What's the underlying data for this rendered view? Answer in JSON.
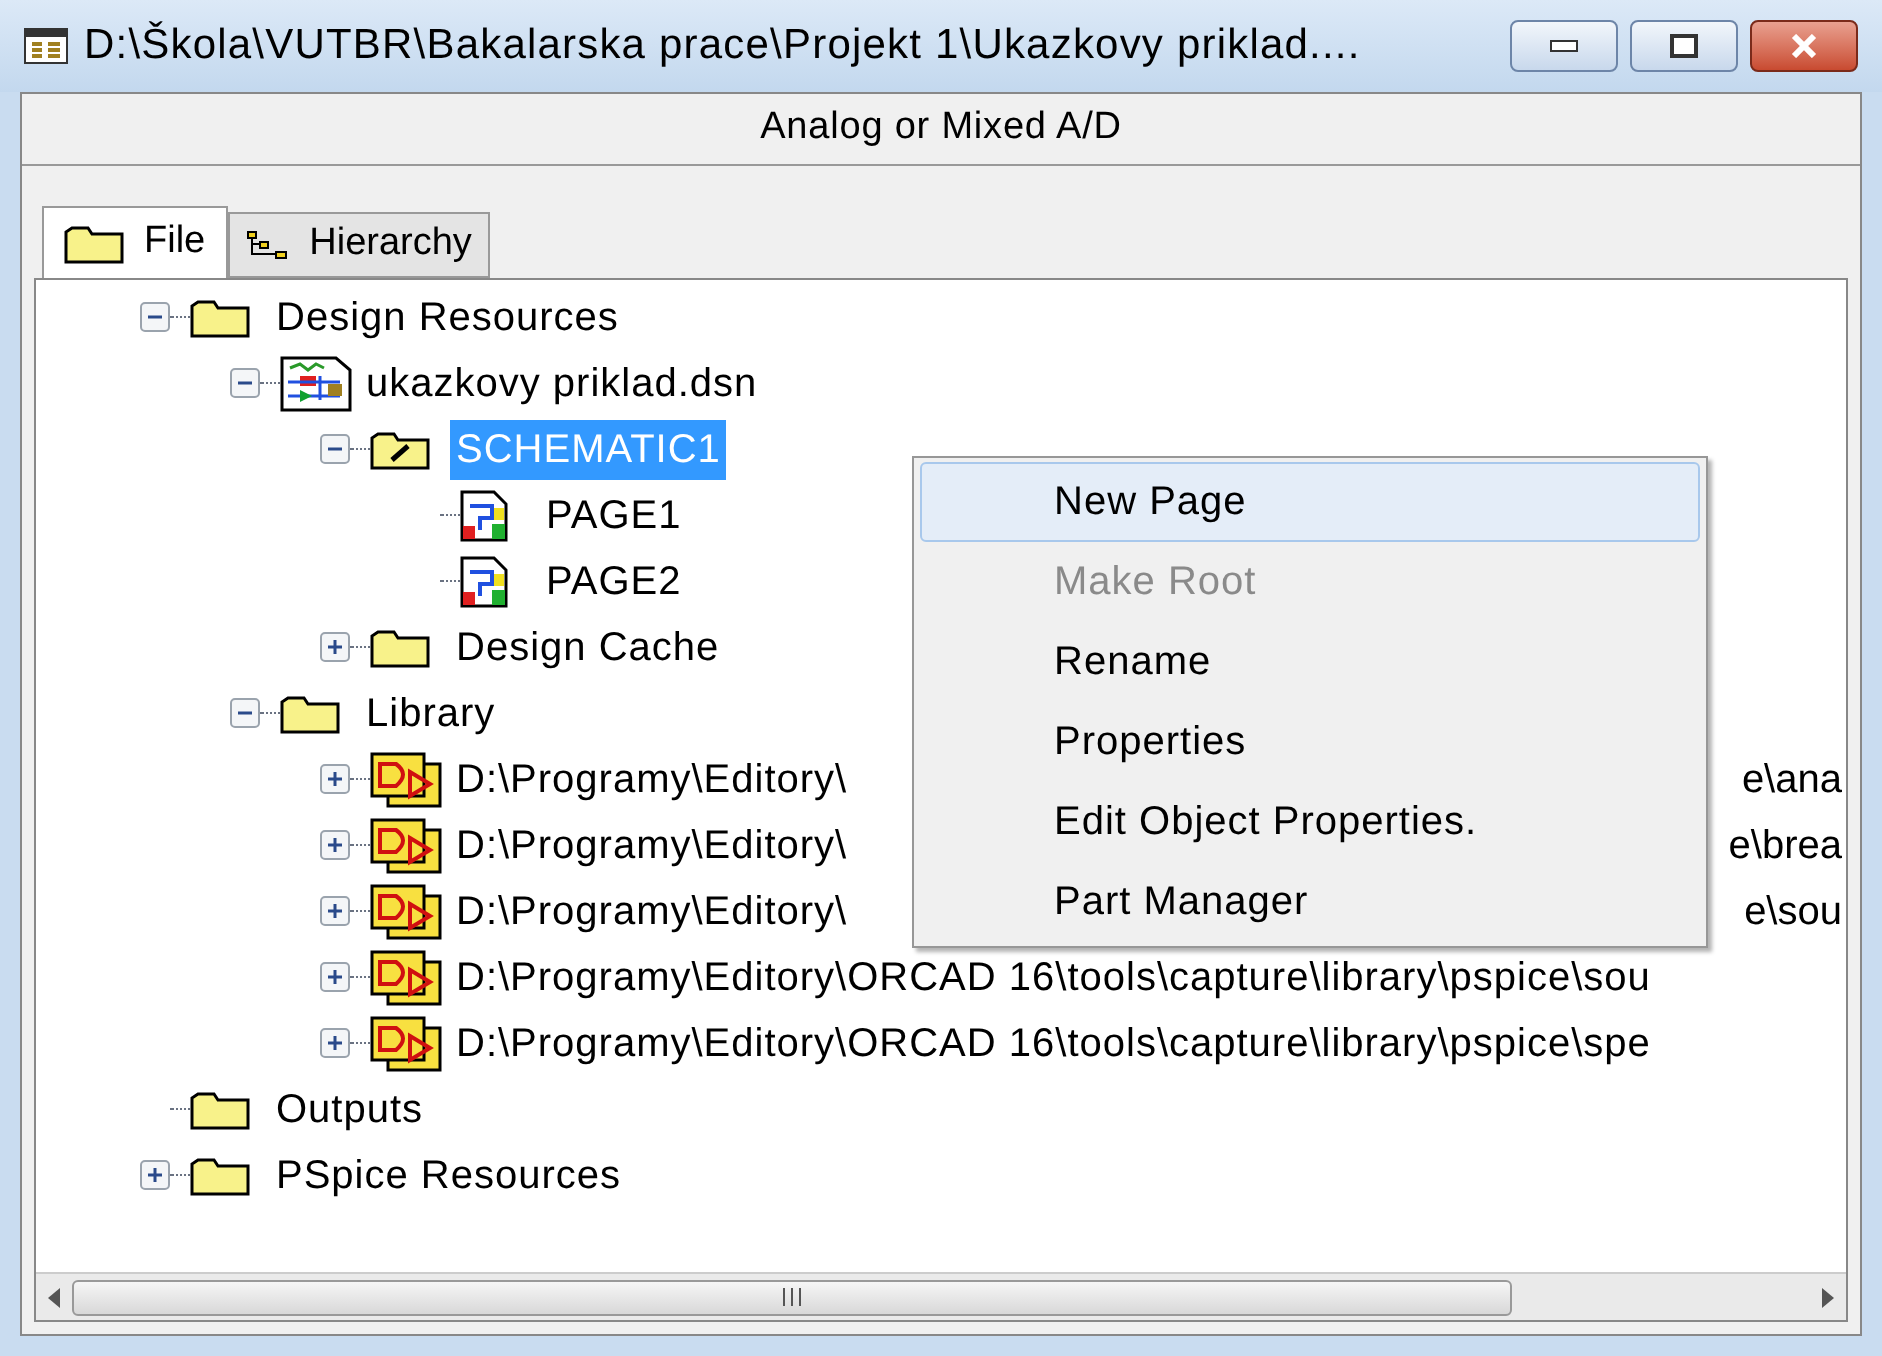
{
  "window": {
    "title": "D:\\Škola\\VUTBR\\Bakalarska prace\\Projekt 1\\Ukazkovy priklad...."
  },
  "header": {
    "text": "Analog or Mixed A/D"
  },
  "tabs": [
    {
      "label": "File",
      "kind": "folder",
      "selected": true
    },
    {
      "label": "Hierarchy",
      "kind": "hierarchy",
      "selected": false
    }
  ],
  "tree": [
    {
      "label": "Design Resources",
      "kind": "folder",
      "expanded": true,
      "selected": false,
      "children": [
        {
          "label": "ukazkovy priklad.dsn",
          "kind": "design",
          "expanded": true,
          "selected": false,
          "children": [
            {
              "label": "SCHEMATIC1",
              "kind": "schematic",
              "expanded": true,
              "selected": true,
              "children": [
                {
                  "label": "PAGE1",
                  "kind": "page",
                  "selected": false
                },
                {
                  "label": "PAGE2",
                  "kind": "page",
                  "selected": false
                }
              ]
            },
            {
              "label": "Design Cache",
              "kind": "folder",
              "expanded": false,
              "selected": false
            }
          ]
        },
        {
          "label": "Library",
          "kind": "folder",
          "expanded": true,
          "selected": false,
          "children": [
            {
              "label": "D:\\Programy\\Editory\\",
              "tail": "e\\ana",
              "kind": "library",
              "expanded": false,
              "selected": false
            },
            {
              "label": "D:\\Programy\\Editory\\",
              "tail": "e\\brea",
              "kind": "library",
              "expanded": false,
              "selected": false
            },
            {
              "label": "D:\\Programy\\Editory\\",
              "tail": "e\\sou",
              "kind": "library",
              "expanded": false,
              "selected": false
            },
            {
              "label": "D:\\Programy\\Editory\\ORCAD 16\\tools\\capture\\library\\pspice\\sou",
              "kind": "library",
              "expanded": false,
              "selected": false
            },
            {
              "label": "D:\\Programy\\Editory\\ORCAD 16\\tools\\capture\\library\\pspice\\spe",
              "kind": "library",
              "expanded": false,
              "selected": false
            }
          ]
        }
      ]
    },
    {
      "label": "Outputs",
      "kind": "folder",
      "selected": false
    },
    {
      "label": "PSpice Resources",
      "kind": "folder",
      "expanded": false,
      "selected": false
    }
  ],
  "context_menu": [
    {
      "label": "New Page",
      "selected": true,
      "disabled": false
    },
    {
      "label": "Make Root",
      "selected": false,
      "disabled": true
    },
    {
      "label": "Rename",
      "selected": false,
      "disabled": false
    },
    {
      "label": "Properties",
      "selected": false,
      "disabled": false
    },
    {
      "label": "Edit Object Properties.",
      "selected": false,
      "disabled": false
    },
    {
      "label": "Part Manager",
      "selected": false,
      "disabled": false
    }
  ]
}
